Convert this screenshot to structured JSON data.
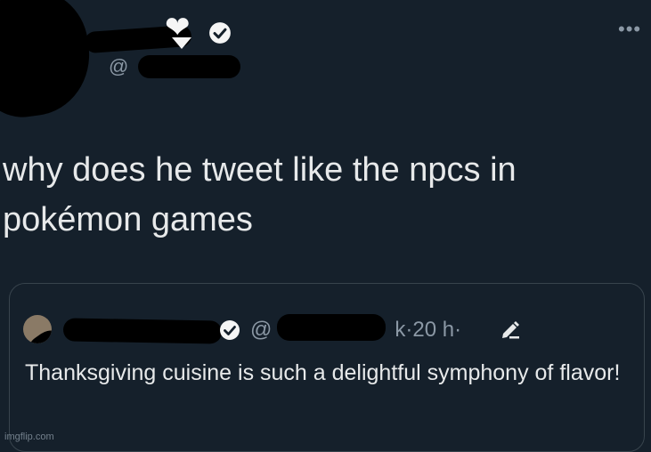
{
  "header": {
    "heart_glyph": "❤",
    "handle_prefix": "@",
    "more_glyph": "•••"
  },
  "tweet": {
    "text": "why does he tweet like the npcs in pokémon games"
  },
  "quote": {
    "handle_prefix": "@",
    "handle_suffix": "k",
    "time": "20 h",
    "separator": "·",
    "text": "Thanksgiving cuisine is such a delightful symphony of flavor!"
  },
  "watermark": "imgflip.com",
  "colors": {
    "background": "#15202b",
    "text": "#e7e9ea",
    "muted": "#8b98a5",
    "border": "#38444d"
  }
}
